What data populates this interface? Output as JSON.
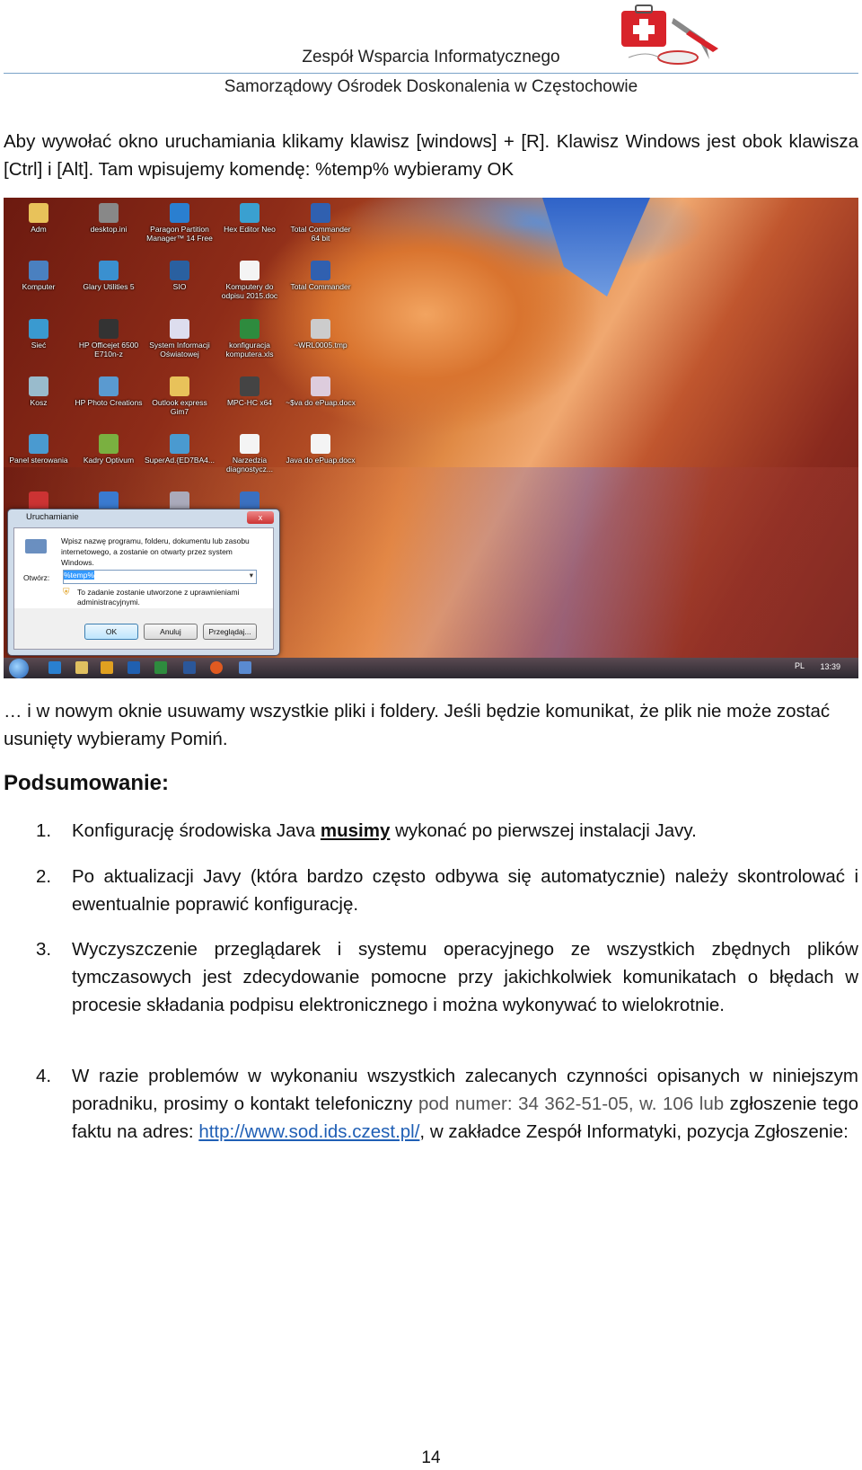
{
  "header": {
    "line1": "Zespół Wsparcia Informatycznego",
    "line2": "Samorządowy Ośrodek Doskonalenia w Częstochowie",
    "logo": "first-aid-kit-pliers-mouse-logo"
  },
  "intro": "Aby wywołać okno uruchamiania klikamy klawisz [windows] + [R]. Klawisz Windows jest obok klawisza [Ctrl] i [Alt]. Tam wpisujemy komendę: %temp% wybieramy OK",
  "desktop": {
    "icons": [
      {
        "label": "Adm",
        "color": "#e8c25a"
      },
      {
        "label": "desktop.ini",
        "color": "#888"
      },
      {
        "label": "Paragon Partition Manager™ 14 Free",
        "color": "#2a7fd0"
      },
      {
        "label": "Hex Editor Neo",
        "color": "#3aa0d0"
      },
      {
        "label": "Total Commander 64 bit",
        "color": "#3060b0"
      },
      {
        "label": "Komputer",
        "color": "#4a80c0"
      },
      {
        "label": "Glary Utilities 5",
        "color": "#3a90d0"
      },
      {
        "label": "SIO",
        "color": "#2a60a0"
      },
      {
        "label": "Komputery do odpisu 2015.doc",
        "color": "#f4f4f4"
      },
      {
        "label": "Total Commander",
        "color": "#3060b0"
      },
      {
        "label": "Sieć",
        "color": "#3a9ad0"
      },
      {
        "label": "HP Officejet 6500 E710n-z",
        "color": "#333"
      },
      {
        "label": "System Informacji Oświatowej",
        "color": "#dde"
      },
      {
        "label": "konfiguracja komputera.xls",
        "color": "#2e8b3e"
      },
      {
        "label": "~WRL0005.tmp",
        "color": "#ccc"
      },
      {
        "label": "Kosz",
        "color": "#9bc"
      },
      {
        "label": "HP Photo Creations",
        "color": "#5a9ad0"
      },
      {
        "label": "Outlook express Gim7",
        "color": "#e8c25a"
      },
      {
        "label": "MPC-HC x64",
        "color": "#444"
      },
      {
        "label": "~$va do ePuap.docx",
        "color": "#dcd"
      },
      {
        "label": "Panel sterowania",
        "color": "#4a9ad0"
      },
      {
        "label": "Kadry Optivum",
        "color": "#7ab040"
      },
      {
        "label": "SuperAd.{ED7BA4...",
        "color": "#4a9ad0"
      },
      {
        "label": "Narzedzia diagnostycz...",
        "color": "#f4f4f4"
      },
      {
        "label": "Java do ePuap.docx",
        "color": "#f4f4f4"
      }
    ],
    "taskbar": {
      "language": "PL",
      "clock": "13:39"
    }
  },
  "run_dialog": {
    "title": "Uruchamianie",
    "close": "x",
    "description": "Wpisz nazwę programu, folderu, dokumentu lub zasobu internetowego, a zostanie on otwarty przez system Windows.",
    "open_label": "Otwórz:",
    "open_value": "%temp%",
    "admin_note": "To zadanie zostanie utworzone z uprawnieniami administracyjnymi.",
    "ok": "OK",
    "cancel": "Anuluj",
    "browse": "Przeglądaj..."
  },
  "after_text": "… i w nowym oknie usuwamy wszystkie pliki i foldery. Jeśli będzie komunikat, że plik nie może zostać usunięty wybieramy Pomiń.",
  "summary": {
    "heading": "Podsumowanie:",
    "items": [
      {
        "num": "1.",
        "pre": "Konfigurację środowiska Java ",
        "bold": "musimy",
        "post": " wykonać po pierwszej instalacji Javy."
      },
      {
        "num": "2.",
        "text": "Po aktualizacji Javy (która bardzo często odbywa się automatycznie) należy skontrolować i ewentualnie poprawić konfigurację."
      },
      {
        "num": "3.",
        "text": "Wyczyszczenie przeglądarek i systemu operacyjnego ze wszystkich zbędnych plików tymczasowych jest zdecydowanie pomocne przy jakichkolwiek komunikatach o błędach w procesie składania podpisu elektronicznego i można wykonywać to wielokrotnie."
      },
      {
        "num": "4.",
        "pre": "W razie problemów w wykonaniu wszystkich zalecanych czynności opisanych w niniejszym poradniku, prosimy o kontakt telefoniczny ",
        "grey": "pod numer: 34 362-51-05, w. 106 lub",
        "mid": " zgłoszenie tego faktu na adres: ",
        "link": "http://www.sod.ids.czest.pl/",
        "post": ", w zakładce Zespół Informatyki, pozycja Zgłoszenie:"
      }
    ]
  },
  "page_number": "14"
}
